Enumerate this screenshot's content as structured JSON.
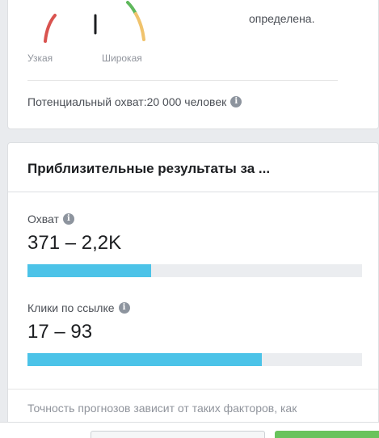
{
  "audience_card": {
    "gauge_left_label": "Узкая",
    "gauge_right_label": "Широкая",
    "defined_text": "определена.",
    "potential_reach": "Потенциальный охват:20 000 человек",
    "gauge_colors": {
      "left": "#d9534f",
      "mid": "#5fb85c",
      "right": "#f0c36d",
      "needle": "#1c1e21"
    }
  },
  "results_card": {
    "title": "Приблизительные результаты за ...",
    "metrics": [
      {
        "label": "Охват",
        "value": "371 – 2,2K",
        "fill_fraction": 0.37
      },
      {
        "label": "Клики по ссылке",
        "value": "17 – 93",
        "fill_fraction": 0.7
      }
    ],
    "accuracy_text": "Точность прогнозов зависит от таких факторов, как",
    "bar_color": "#4cc3e8"
  }
}
